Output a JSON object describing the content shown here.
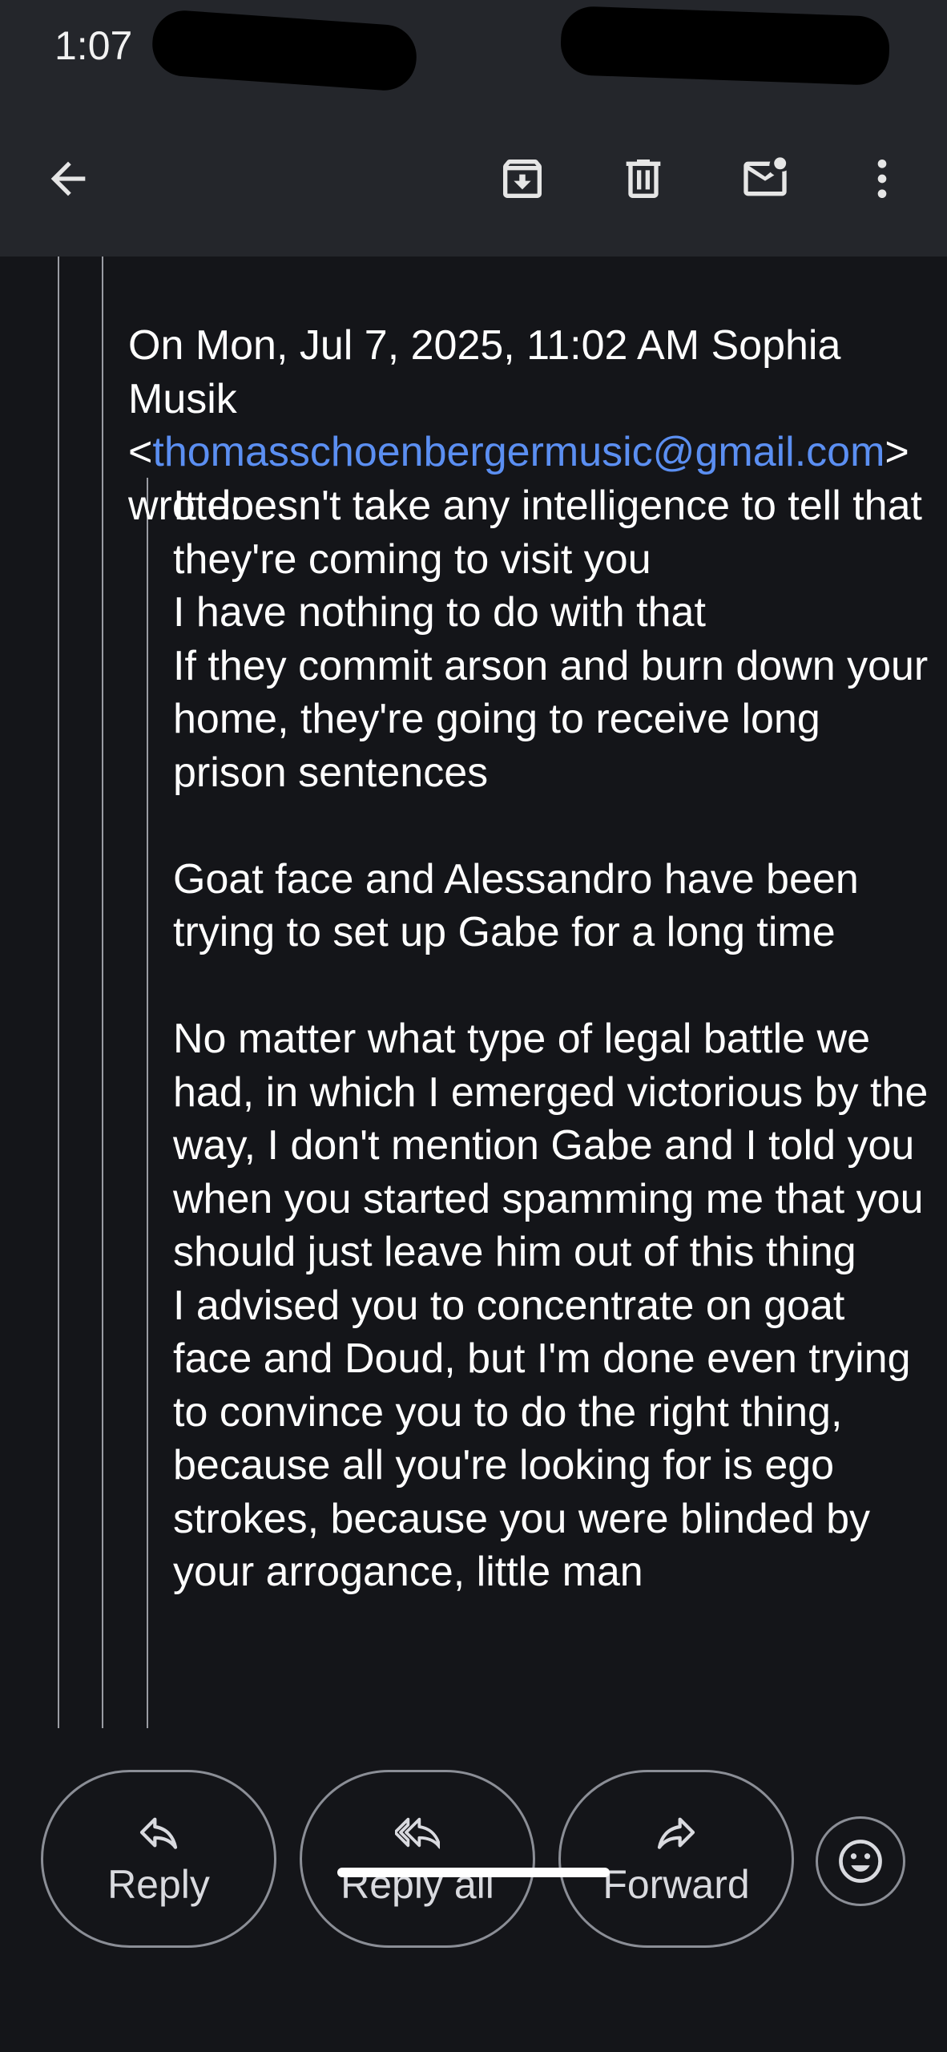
{
  "status_bar": {
    "time": "1:07"
  },
  "app_bar": {
    "icons": [
      "back-arrow-icon",
      "archive-icon",
      "delete-icon",
      "mark-unread-icon",
      "more-vert-icon"
    ]
  },
  "email": {
    "attribution_prefix": "On Mon, Jul 7, 2025, 11:02 AM Sophia Musik <",
    "attribution_email": "thomasschoenbergermusic@gmail.com",
    "attribution_suffix": "> wrote:",
    "quoted_text": "It doesn't take any intelligence to tell that they're coming to visit you\nI have nothing to do with that\nIf they commit arson and burn down your home, they're going to receive long prison sentences\n\nGoat face and Alessandro have been trying to set up Gabe for a long time\n\nNo matter what type of legal battle we had, in which I emerged victorious by the way, I don't mention Gabe and I told you when you started spamming me that you should just leave him out of this thing\nI advised you to concentrate on goat face and Doud, but I'm done even trying to convince you to do the right thing, because all you're looking for is ego strokes, because you were blinded by your arrogance, little man"
  },
  "actions": {
    "reply": "Reply",
    "reply_all": "Reply all",
    "forward": "Forward"
  },
  "colors": {
    "background": "#141519",
    "app_bar": "#24262b",
    "link": "#5b8ff2"
  }
}
